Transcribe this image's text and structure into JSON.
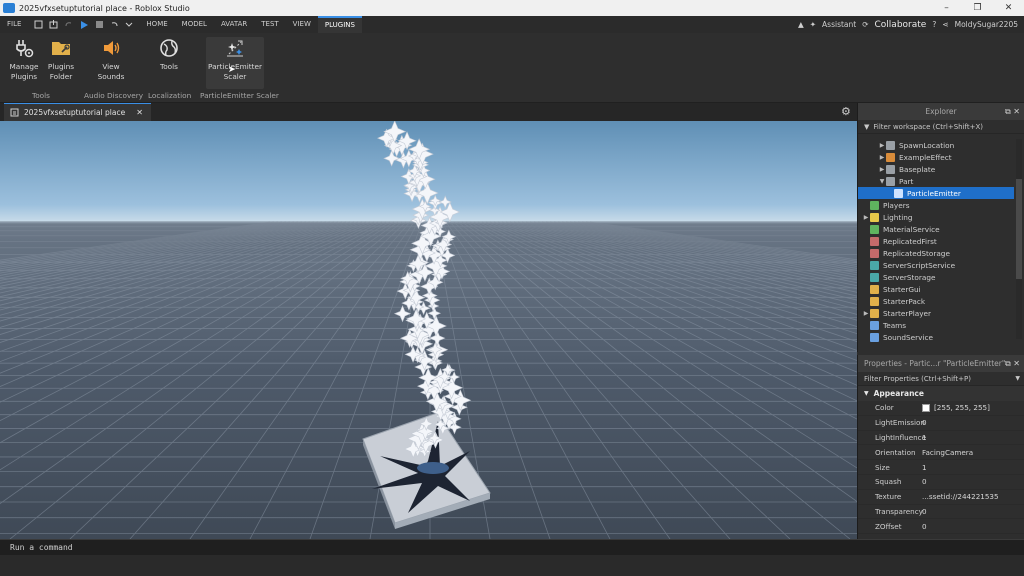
{
  "window": {
    "title": "2025vfxsetuptutorial place - Roblox Studio",
    "min": "–",
    "max": "❐",
    "close": "✕"
  },
  "menu": {
    "file": "FILE",
    "tabs": [
      "HOME",
      "MODEL",
      "AVATAR",
      "TEST",
      "VIEW",
      "PLUGINS"
    ],
    "active_tab": "PLUGINS"
  },
  "topright": {
    "assistant": "Assistant",
    "collaborate": "Collaborate",
    "username": "MoldySugar2205"
  },
  "ribbon": {
    "buttons": [
      {
        "label": "Manage\nPlugins",
        "icon": "plug-gear-icon"
      },
      {
        "label": "Plugins\nFolder",
        "icon": "folder-icon"
      },
      {
        "label": "View\nSounds",
        "icon": "speaker-icon"
      },
      {
        "label": "Tools",
        "icon": "globe-icon"
      },
      {
        "label": "ParticleEmitter\nScaler",
        "icon": "particle-scaler-icon"
      }
    ],
    "groups": [
      "Tools",
      "Audio Discovery",
      "Localization",
      "ParticleEmitter Scaler"
    ]
  },
  "document_tab": {
    "label": "2025vfxsetuptutorial place",
    "close": "✕"
  },
  "explorer": {
    "title": "Explorer",
    "filter": "Filter workspace (Ctrl+Shift+X)",
    "items": [
      {
        "label": "SpawnLocation",
        "color": "#9aa0a6"
      },
      {
        "label": "ExampleEffect",
        "color": "#d98c3a"
      },
      {
        "label": "Baseplate",
        "color": "#9aa0a6"
      },
      {
        "label": "Part",
        "color": "#9aa0a6"
      },
      {
        "label": "ParticleEmitter",
        "color": "#cfe3ff"
      },
      {
        "label": "Players",
        "color": "#5fb35f"
      },
      {
        "label": "Lighting",
        "color": "#e6c84a"
      },
      {
        "label": "MaterialService",
        "color": "#5fb35f"
      },
      {
        "label": "ReplicatedFirst",
        "color": "#c46a6a"
      },
      {
        "label": "ReplicatedStorage",
        "color": "#c46a6a"
      },
      {
        "label": "ServerScriptService",
        "color": "#4aa8a8"
      },
      {
        "label": "ServerStorage",
        "color": "#4aa8a8"
      },
      {
        "label": "StarterGui",
        "color": "#e0b04a"
      },
      {
        "label": "StarterPack",
        "color": "#e0b04a"
      },
      {
        "label": "StarterPlayer",
        "color": "#e0b04a"
      },
      {
        "label": "Teams",
        "color": "#6aa0e0"
      },
      {
        "label": "SoundService",
        "color": "#6aa0e0"
      }
    ]
  },
  "properties": {
    "title": "Properties - Partic...r \"ParticleEmitter\"",
    "filter": "Filter Properties (Ctrl+Shift+P)",
    "section": "Appearance",
    "rows": [
      {
        "name": "Color",
        "value": "[255, 255, 255]"
      },
      {
        "name": "LightEmission",
        "value": "0"
      },
      {
        "name": "LightInfluence",
        "value": "1"
      },
      {
        "name": "Orientation",
        "value": "FacingCamera"
      },
      {
        "name": "Size",
        "value": "1"
      },
      {
        "name": "Squash",
        "value": "0"
      },
      {
        "name": "Texture",
        "value": "...ssetid://244221535"
      },
      {
        "name": "Transparency",
        "value": "0"
      },
      {
        "name": "ZOffset",
        "value": "0"
      }
    ]
  },
  "command_bar": {
    "placeholder": "Run a command"
  }
}
